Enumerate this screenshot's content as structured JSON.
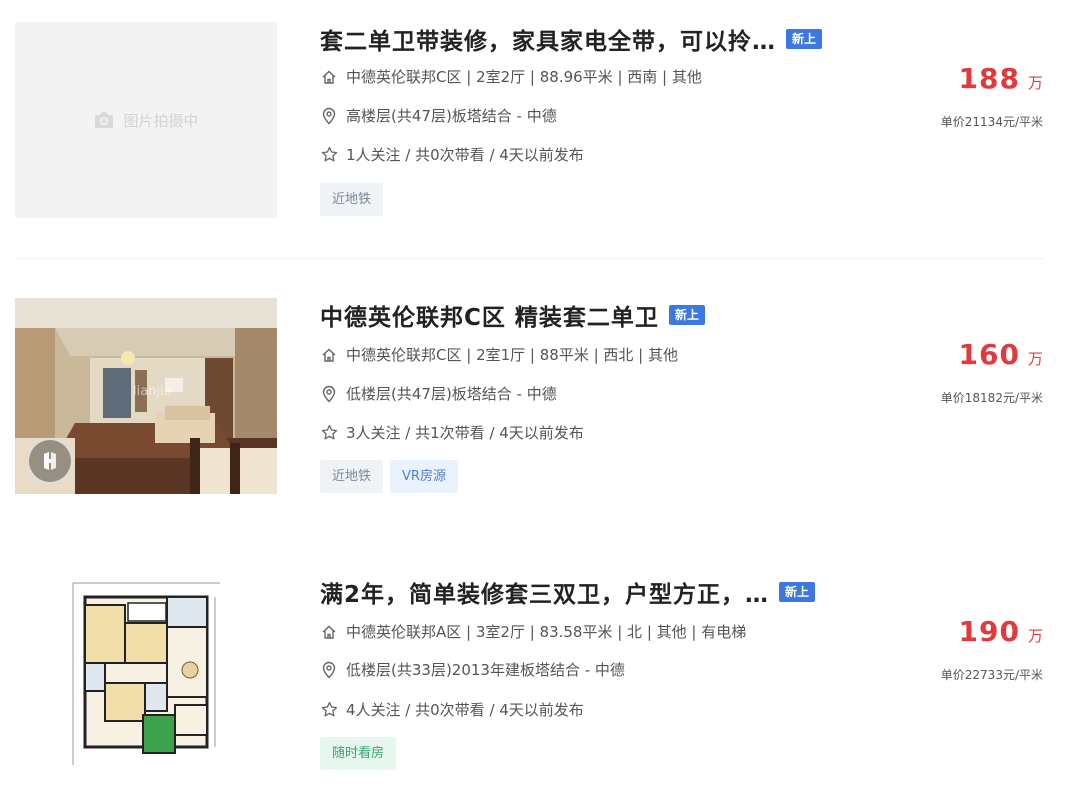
{
  "listings": [
    {
      "title": "套二单卫带装修，家具家电全带，可以拎…",
      "badge": "新上",
      "info_house": "中德英伦联邦C区 | 2室2厅 | 88.96平米 | 西南 | 其他",
      "info_floor": "高楼层(共47层)板塔结合 - 中德",
      "info_follow": "1人关注 / 共0次带看 / 4天以前发布",
      "tags": [
        "近地铁"
      ],
      "price": "188",
      "price_unit": "万",
      "unit_price": "单价21134元/平米",
      "thumb": {
        "type": "placeholder",
        "text": "图片拍摄中",
        "icon": "camera-icon"
      }
    },
    {
      "title": "中德英伦联邦C区 精装套二单卫",
      "badge": "新上",
      "info_house": "中德英伦联邦C区 | 2室1厅 | 88平米 | 西北 | 其他",
      "info_floor": "低楼层(共47层)板塔结合 - 中德",
      "info_follow": "3人关注 / 共1次带看 / 4天以前发布",
      "tags": [
        "近地铁",
        "VR房源"
      ],
      "price": "160",
      "price_unit": "万",
      "unit_price": "单价18182元/平米",
      "thumb": {
        "type": "photo",
        "watermark": "lianjia",
        "icon": "vr-icon"
      }
    },
    {
      "title": "满2年，简单装修套三双卫，户型方正，…",
      "badge": "新上",
      "info_house": "中德英伦联邦A区 | 3室2厅 | 83.58平米 | 北 | 其他 | 有电梯",
      "info_floor": "低楼层(共33层)2013年建板塔结合 - 中德",
      "info_follow": "4人关注 / 共0次带看 / 4天以前发布",
      "tags": [
        "随时看房"
      ],
      "price": "190",
      "price_unit": "万",
      "unit_price": "单价22733元/平米",
      "thumb": {
        "type": "floorplan"
      }
    }
  ],
  "colors": {
    "price": "#e4393c",
    "badge": "#3b78e0",
    "tag_gray": "#7a8a99",
    "tag_blue": "#4f7fd6",
    "tag_green": "#3aa56f"
  }
}
